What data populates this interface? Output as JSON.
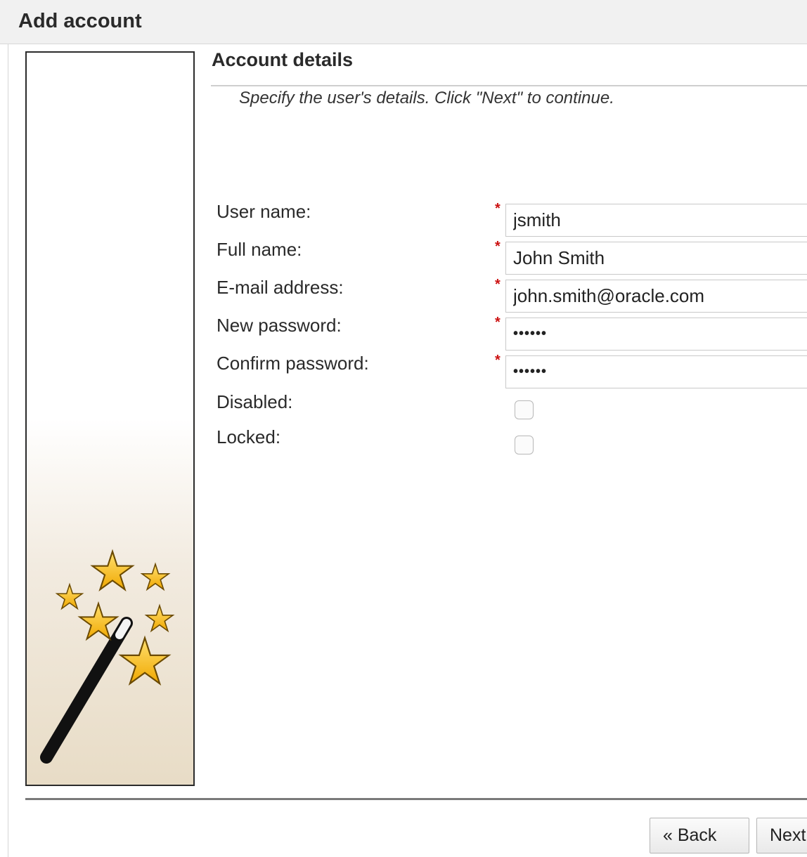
{
  "window": {
    "title": "Add account"
  },
  "section": {
    "title": "Account details",
    "instructions": "Specify the user's details. Click \"Next\" to continue."
  },
  "form": {
    "required_marker": "*",
    "user_name": {
      "label": "User name:",
      "value": "jsmith"
    },
    "full_name": {
      "label": "Full name:",
      "value": "John Smith"
    },
    "email": {
      "label": "E-mail address:",
      "value": "john.smith@oracle.com"
    },
    "new_password": {
      "label": "New password:",
      "value": "••••••"
    },
    "confirm_password": {
      "label": "Confirm password:",
      "value": "••••••"
    },
    "disabled": {
      "label": "Disabled:",
      "checked": false
    },
    "locked": {
      "label": "Locked:",
      "checked": false
    }
  },
  "buttons": {
    "back": "« Back",
    "next": "Next »"
  },
  "illustration": {
    "icon": "magic-wand-icon",
    "star_color": "#f5c400",
    "wand_color": "#111111"
  }
}
